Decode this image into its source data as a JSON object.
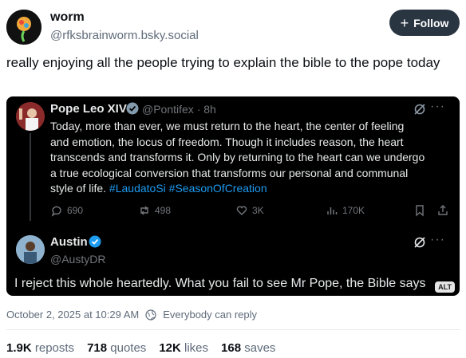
{
  "author": {
    "display_name": "worm",
    "handle": "@rfksbrainworm.bsky.social"
  },
  "follow_button": {
    "label": "Follow"
  },
  "post": {
    "text": "really enjoying all the people trying to explain the bible to the pope today"
  },
  "embed": {
    "quoted": {
      "name": "Pope Leo XIV",
      "handle_time": "@Pontifex · 8h",
      "body": "Today, more than ever, we must return to the heart, the center of feeling and emotion, the locus of freedom. Though it includes reason, the heart transcends and transforms it. Only by returning to the heart can we undergo a true ecological conversion that transforms our personal and communal style of life.",
      "hashtags": "#LaudatoSi #SeasonOfCreation",
      "stats": {
        "replies": "690",
        "reposts": "498",
        "likes": "3K",
        "views": "170K"
      }
    },
    "reply": {
      "name": "Austin",
      "handle": "@AustyDR",
      "body": "I reject this whole heartedly. What you fail to see Mr Pope, the Bible says"
    },
    "alt_badge": "ALT"
  },
  "meta": {
    "timestamp": "October 2, 2025 at 10:29 AM",
    "reply_setting": "Everybody can reply"
  },
  "engagement": {
    "reposts_count": "1.9K",
    "reposts_label": "reposts",
    "quotes_count": "718",
    "quotes_label": "quotes",
    "likes_count": "12K",
    "likes_label": "likes",
    "saves_count": "168",
    "saves_label": "saves"
  },
  "colors": {
    "follow_bg": "#2a3542",
    "hashtag": "#1d9bf0",
    "verified": "#1d9bf0",
    "embed_bg": "#000000"
  }
}
